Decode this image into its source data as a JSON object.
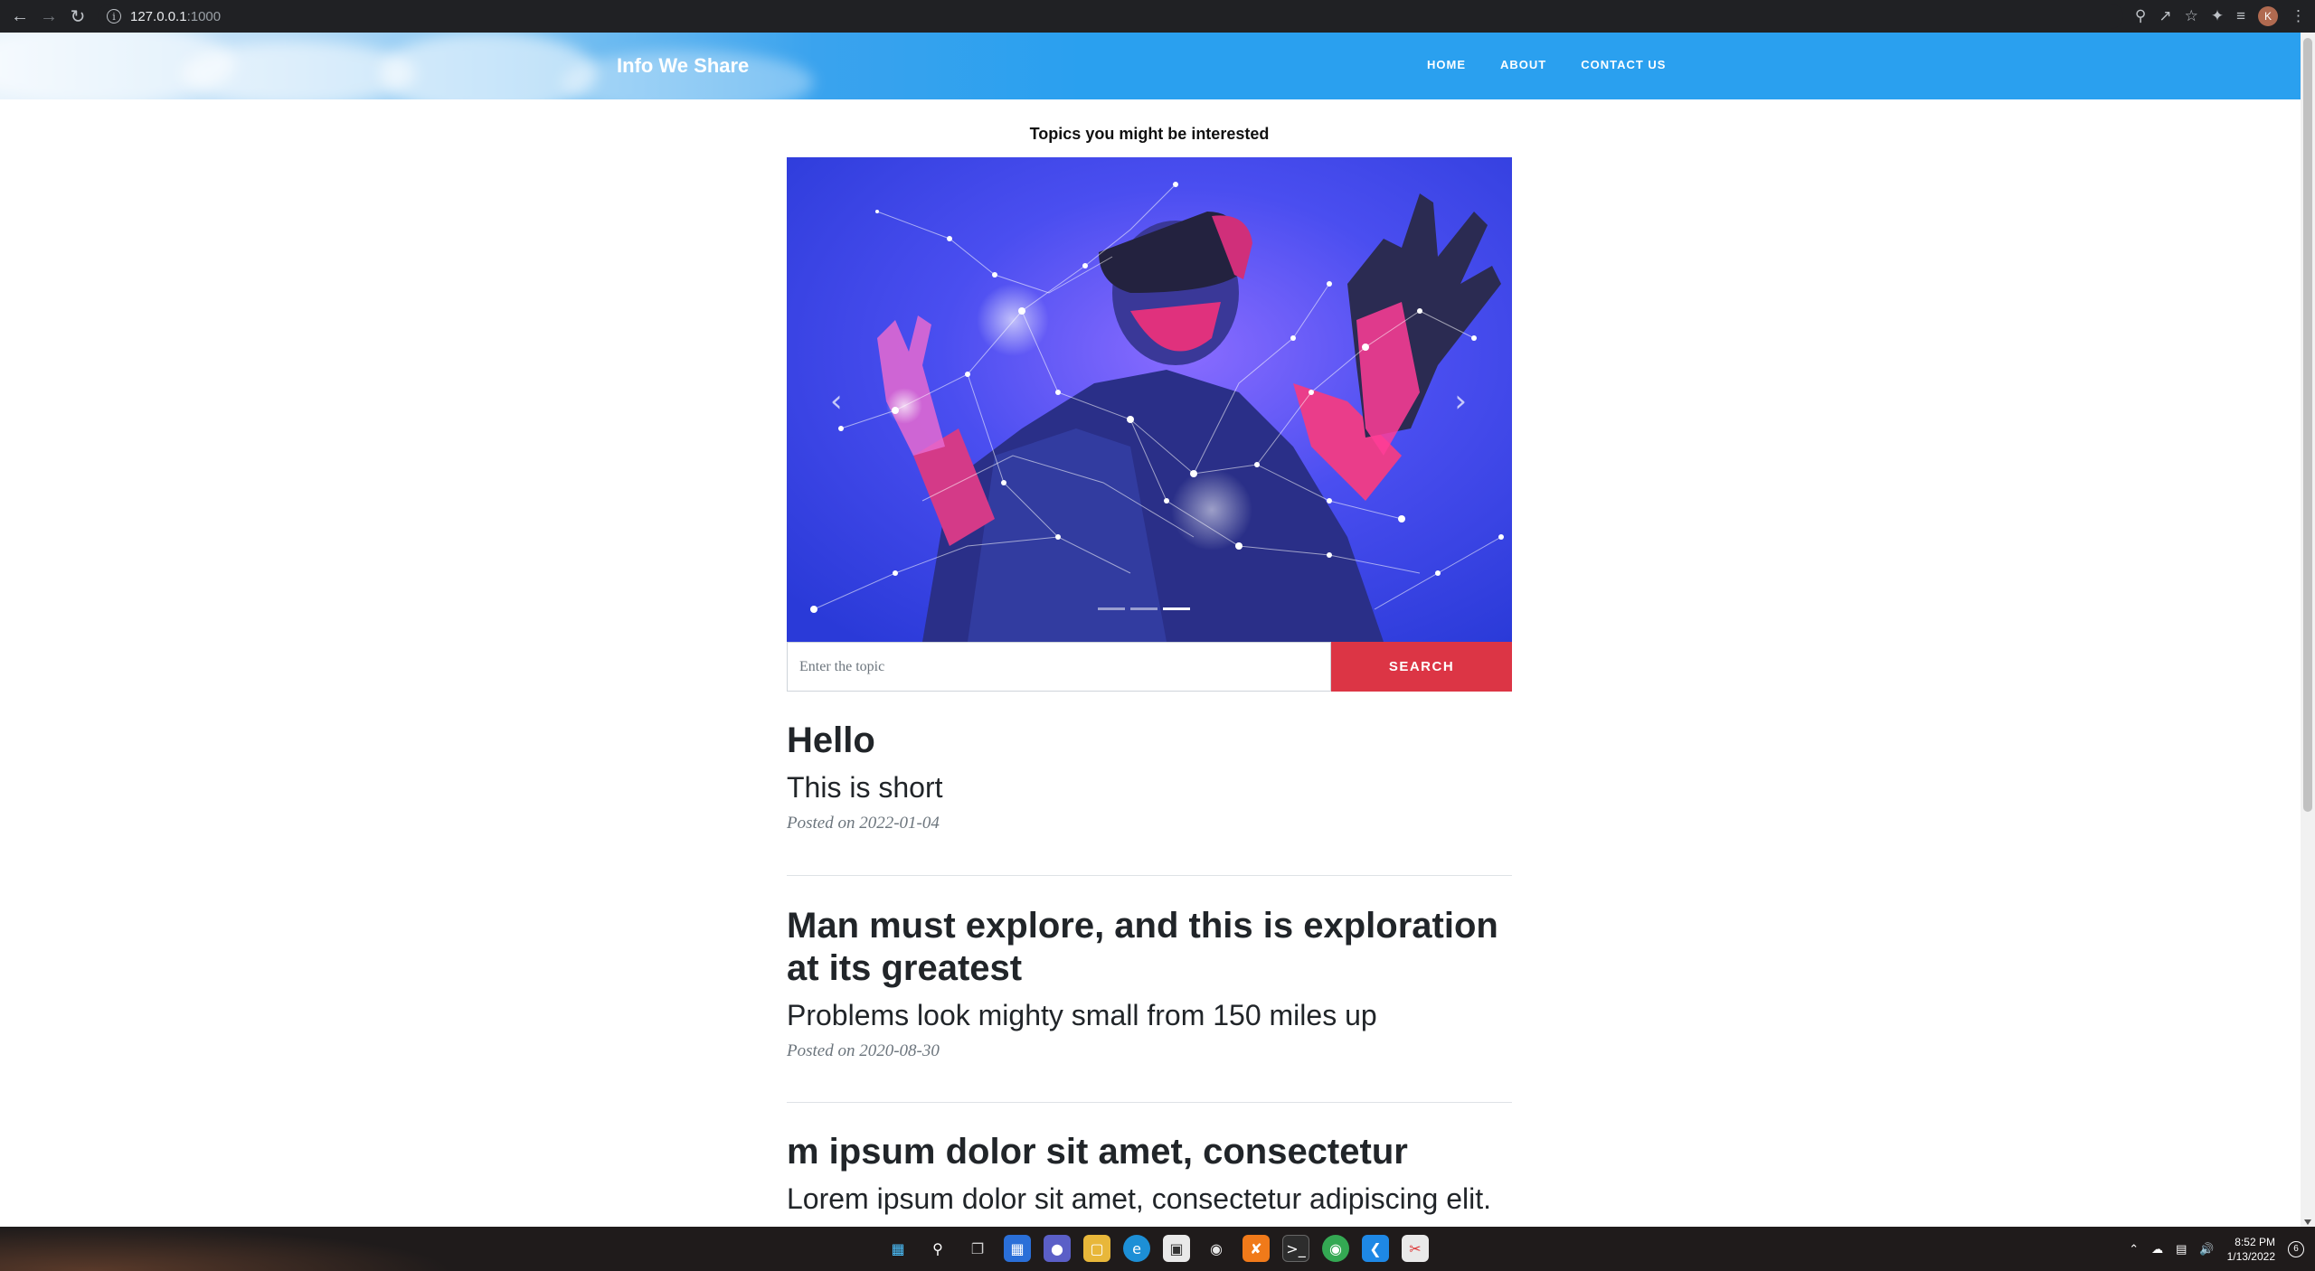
{
  "browser": {
    "url_host": "127.0.0.1",
    "url_port": ":1000",
    "avatar_initial": "K"
  },
  "site": {
    "brand": "Info We Share",
    "nav": [
      "HOME",
      "ABOUT",
      "CONTACT US"
    ]
  },
  "topics_heading": "Topics you might be interested",
  "carousel": {
    "slide_count": 3,
    "active_index": 2,
    "prev_glyph": "‹",
    "next_glyph": "›"
  },
  "search": {
    "placeholder": "Enter the topic",
    "button_label": "SEARCH"
  },
  "posts": [
    {
      "title": "Hello",
      "subtitle": "This is short",
      "meta": "Posted on 2022-01-04"
    },
    {
      "title": "Man must explore, and this is exploration at its greatest",
      "subtitle": "Problems look mighty small from 150 miles up",
      "meta": "Posted on 2020-08-30"
    },
    {
      "title": "m ipsum dolor sit amet, consectetur",
      "subtitle": "Lorem ipsum dolor sit amet, consectetur adipiscing elit.",
      "meta": ""
    }
  ],
  "taskbar": {
    "time": "8:52 PM",
    "date": "1/13/2022",
    "notification_count": "6"
  },
  "colors": {
    "navbar": "#2aa0ef",
    "search_button": "#dc3545",
    "chrome": "#202124",
    "taskbar": "#1f1b1b"
  }
}
